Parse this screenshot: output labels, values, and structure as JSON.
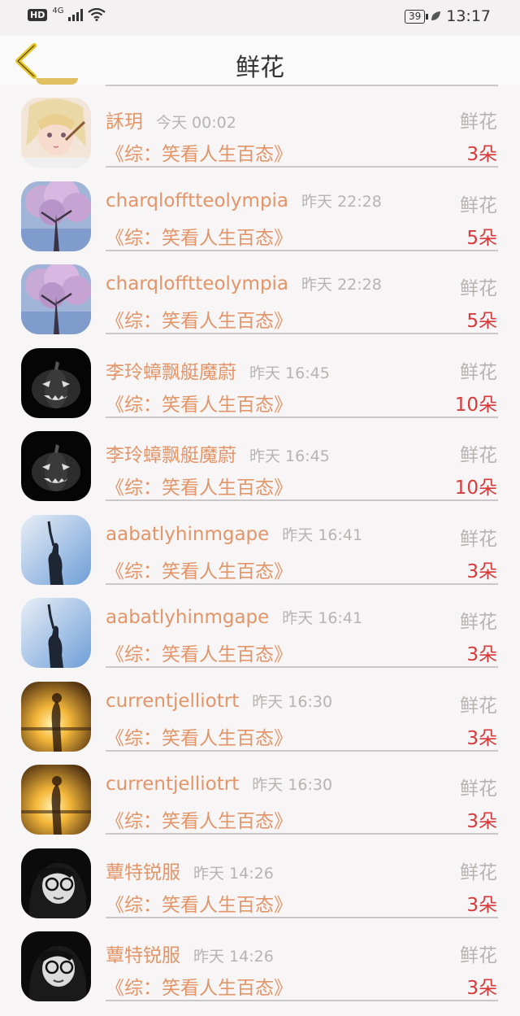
{
  "status_bar": {
    "hd": "HD",
    "network": "4G",
    "battery": "39",
    "time": "13:17"
  },
  "header": {
    "title": "鲜花"
  },
  "items": [
    {
      "name": "訸玥",
      "time": "今天 00:02",
      "gift": "鲜花",
      "book": "《综：笑看人生百态》",
      "count": "3朵",
      "avatar": "anime-girl"
    },
    {
      "name": "charqlofftteolympia",
      "time": "昨天 22:28",
      "gift": "鲜花",
      "book": "《综：笑看人生百态》",
      "count": "5朵",
      "avatar": "cherry-tree"
    },
    {
      "name": "charqlofftteolympia",
      "time": "昨天 22:28",
      "gift": "鲜花",
      "book": "《综：笑看人生百态》",
      "count": "5朵",
      "avatar": "cherry-tree"
    },
    {
      "name": "李玲蟑飘艇魔蔚",
      "time": "昨天 16:45",
      "gift": "鲜花",
      "book": "《综：笑看人生百态》",
      "count": "10朵",
      "avatar": "pumpkin"
    },
    {
      "name": "李玲蟑飘艇魔蔚",
      "time": "昨天 16:45",
      "gift": "鲜花",
      "book": "《综：笑看人生百态》",
      "count": "10朵",
      "avatar": "pumpkin"
    },
    {
      "name": "aabatlyhinmgape",
      "time": "昨天 16:41",
      "gift": "鲜花",
      "book": "《综：笑看人生百态》",
      "count": "3朵",
      "avatar": "silhouette-sky"
    },
    {
      "name": "aabatlyhinmgape",
      "time": "昨天 16:41",
      "gift": "鲜花",
      "book": "《综：笑看人生百态》",
      "count": "3朵",
      "avatar": "silhouette-sky"
    },
    {
      "name": "currentjelliotrt",
      "time": "昨天 16:30",
      "gift": "鲜花",
      "book": "《综：笑看人生百态》",
      "count": "3朵",
      "avatar": "sunset-figure"
    },
    {
      "name": "currentjelliotrt",
      "time": "昨天 16:30",
      "gift": "鲜花",
      "book": "《综：笑看人生百态》",
      "count": "3朵",
      "avatar": "sunset-figure"
    },
    {
      "name": "蕈特锐服",
      "time": "昨天 14:26",
      "gift": "鲜花",
      "book": "《综：笑看人生百态》",
      "count": "3朵",
      "avatar": "bw-girl"
    },
    {
      "name": "蕈特锐服",
      "time": "昨天 14:26",
      "gift": "鲜花",
      "book": "《综：笑看人生百态》",
      "count": "3朵",
      "avatar": "bw-girl"
    }
  ]
}
